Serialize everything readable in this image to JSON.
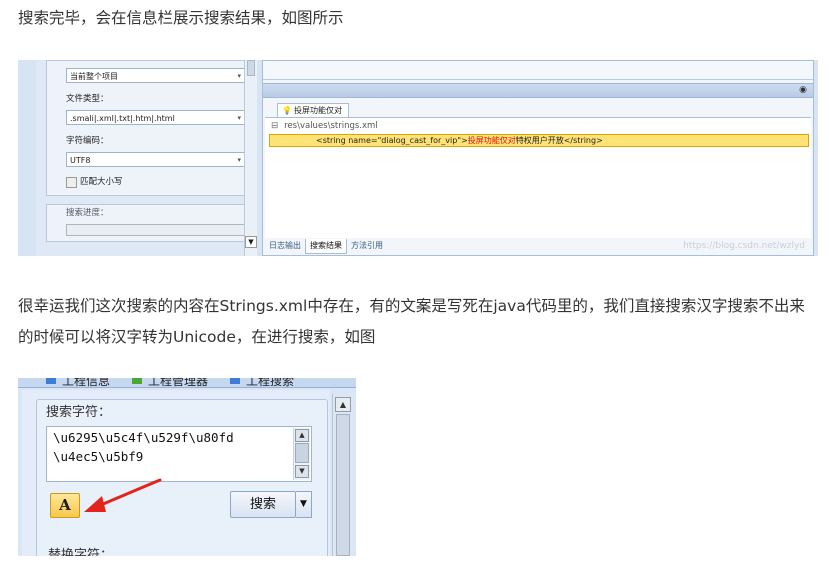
{
  "paragraphs": {
    "p1": "搜索完毕，会在信息栏展示搜索结果，如图所示",
    "p2": "很幸运我们这次搜索的内容在Strings.xml中存在，有的文案是写死在java代码里的，我们直接搜索汉字搜索不出来的时候可以将汉字转为Unicode，在进行搜索，如图"
  },
  "screenshot1": {
    "scope_value": "当前整个项目",
    "file_type_label": "文件类型：",
    "file_type_value": ".smali|.xml|.txt|.htm|.html",
    "encoding_label": "字符编码：",
    "encoding_value": "UTF8",
    "match_case_label": "匹配大小写",
    "progress_label": "搜索进度：",
    "result_tab": "投屏功能仅对",
    "tree_node": "res\\values\\strings.xml",
    "hit_prefix": "<string name=\"dialog_cast_for_vip\">",
    "hit_keyword": "投屏功能仅对",
    "hit_suffix": "特权用户开放</string>",
    "bottom_tabs": [
      "日志输出",
      "搜索结果",
      "方法引用"
    ],
    "watermark": "https://blog.csdn.net/wzlyd"
  },
  "screenshot2": {
    "tabs": [
      "工程信息",
      "工程管理器",
      "工程搜索"
    ],
    "search_label": "搜索字符：",
    "search_lines": [
      "\\u6295\\u5c4f\\u529f\\u80fd",
      "\\u4ec5\\u5bf9"
    ],
    "convert_glyph": "A",
    "search_button": "搜索",
    "replace_label": "替换字符："
  }
}
